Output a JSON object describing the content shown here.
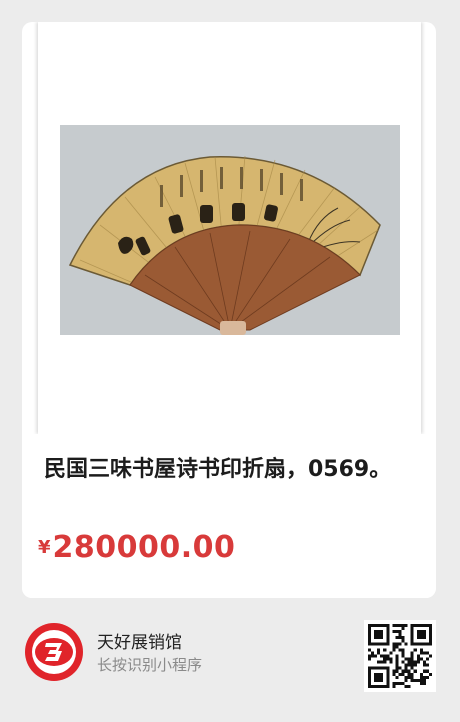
{
  "product": {
    "title": "民国三味书屋诗书印折扇，0569。",
    "price_currency": "¥",
    "price_amount": "280000.00",
    "image_subject": "folding-fan-photo"
  },
  "shop": {
    "name": "天好展销馆",
    "hint": "长按识别小程序",
    "logo_icon": "shop-logo-icon",
    "qr_icon": "qr-code-icon"
  },
  "colors": {
    "price": "#d83a3a",
    "logo_red": "#e0242a",
    "background": "#ececec"
  }
}
